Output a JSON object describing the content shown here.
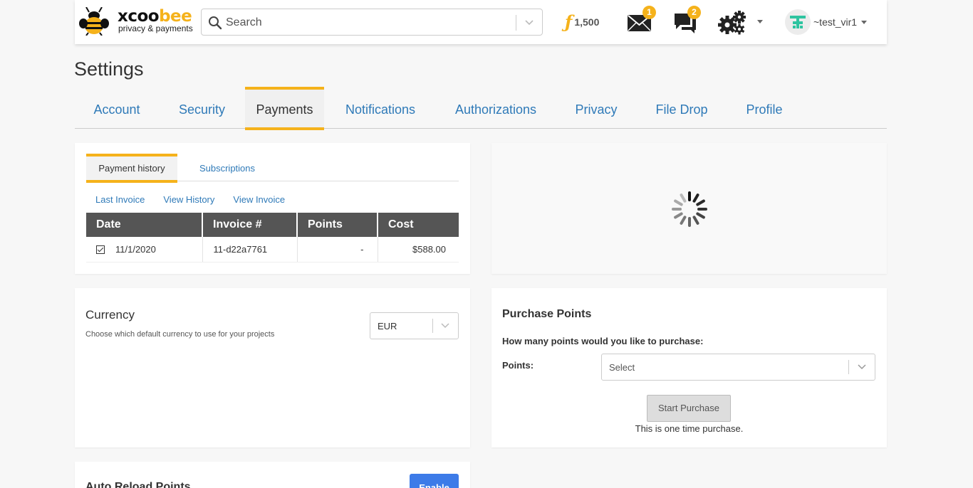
{
  "brand": {
    "word_prefix": "xcoo",
    "word_suffix": "bee",
    "tagline": "privacy & payments"
  },
  "header": {
    "search_placeholder": "Search",
    "points": "1,500",
    "mail_badge": "1",
    "chat_badge": "2",
    "username": "~test_vir1"
  },
  "page": {
    "title": "Settings"
  },
  "tabs": [
    {
      "label": "Account"
    },
    {
      "label": "Security"
    },
    {
      "label": "Payments"
    },
    {
      "label": "Notifications"
    },
    {
      "label": "Authorizations"
    },
    {
      "label": "Privacy"
    },
    {
      "label": "File Drop"
    },
    {
      "label": "Profile"
    }
  ],
  "payments": {
    "subtabs": [
      {
        "label": "Payment history"
      },
      {
        "label": "Subscriptions"
      }
    ],
    "links": [
      {
        "label": "Last Invoice"
      },
      {
        "label": "View History"
      },
      {
        "label": "View Invoice"
      }
    ],
    "table": {
      "headers": [
        "Date",
        "Invoice #",
        "Points",
        "Cost"
      ],
      "rows": [
        {
          "date": "11/1/2020",
          "invoice": "11-d22a7761",
          "points": "-",
          "cost": "$588.00"
        }
      ]
    }
  },
  "currency": {
    "title": "Currency",
    "description": "Choose which default currency to use for your projects",
    "selected": "EUR"
  },
  "purchase": {
    "title": "Purchase Points",
    "question": "How many points would you like to purchase:",
    "points_label": "Points:",
    "select_placeholder": "Select",
    "button": "Start Purchase",
    "note": "This is one time purchase."
  },
  "auto_reload": {
    "title": "Auto Reload Points",
    "button": "Enable"
  },
  "colors": {
    "accent": "#f5b21b",
    "link": "#2f7ab8",
    "table_header": "#555555",
    "primary_button": "#3d7be8"
  }
}
